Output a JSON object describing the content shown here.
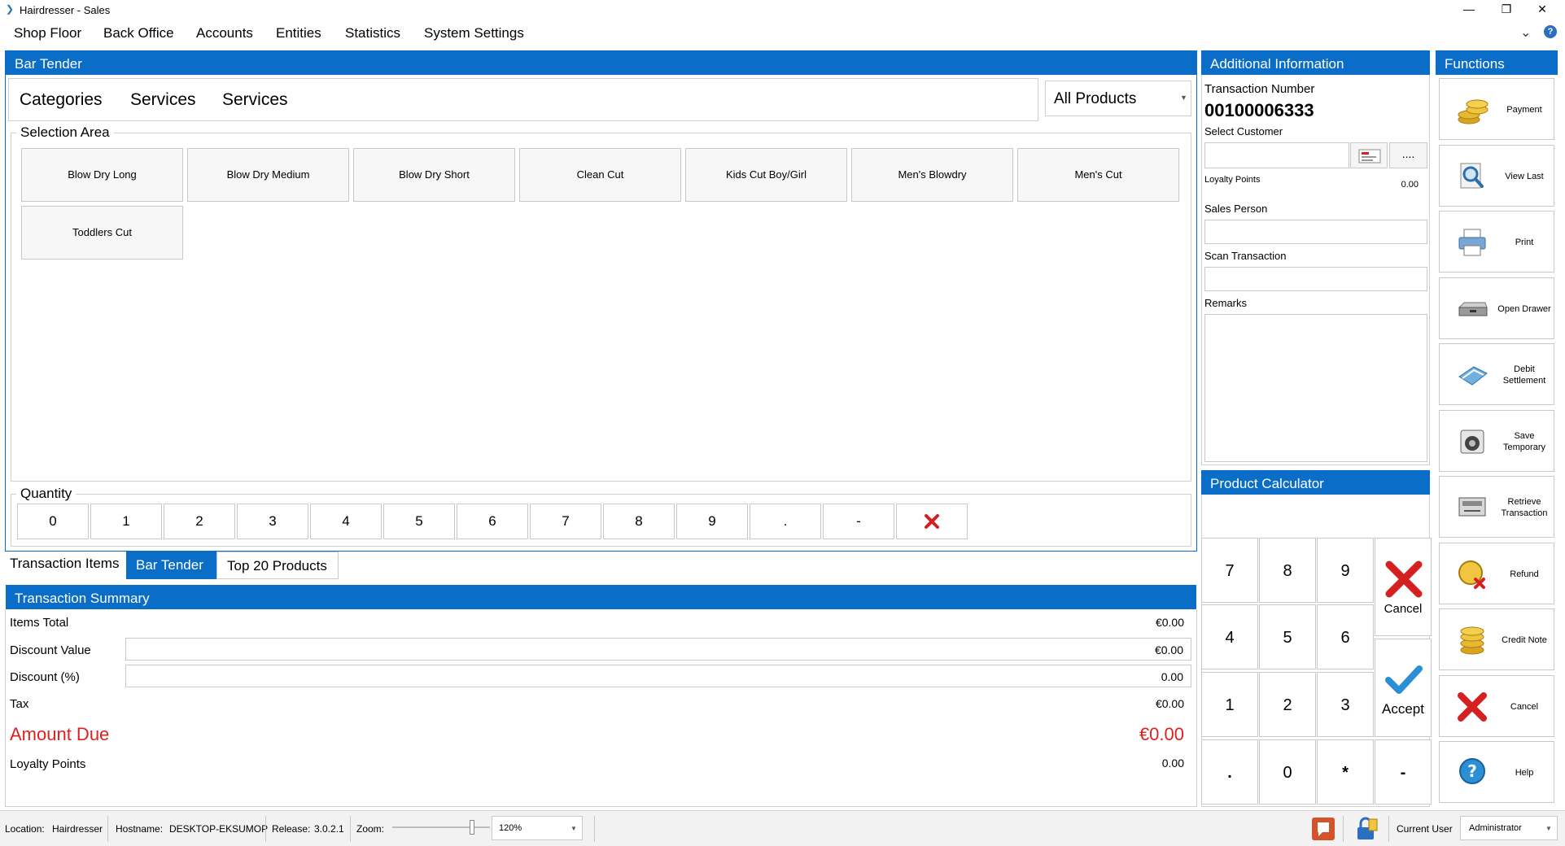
{
  "window": {
    "title": "Hairdresser - Sales",
    "controls": [
      "—",
      "❐",
      "✕"
    ]
  },
  "menu": [
    "Shop Floor",
    "Back Office",
    "Accounts",
    "Entities",
    "Statistics",
    "System Settings"
  ],
  "bar_tender": {
    "title": "Bar Tender",
    "breadcrumb": [
      "Categories",
      "Services",
      "Services"
    ],
    "filter_value": "All Products",
    "selection_area_label": "Selection Area",
    "products": [
      "Blow Dry Long",
      "Blow Dry Medium",
      "Blow Dry Short",
      "Clean Cut",
      "Kids Cut Boy/Girl",
      "Men's Blowdry",
      "Men's Cut",
      "Toddlers Cut"
    ],
    "quantity_label": "Quantity",
    "quantity_keys": [
      "0",
      "1",
      "2",
      "3",
      "4",
      "5",
      "6",
      "7",
      "8",
      "9",
      ".",
      "-"
    ]
  },
  "tabs": {
    "section_label": "Transaction Items",
    "items": [
      "Bar Tender",
      "Top 20 Products"
    ],
    "active": 0
  },
  "summary": {
    "title": "Transaction Summary",
    "items_total_label": "Items Total",
    "items_total": "€0.00",
    "discount_value_label": "Discount Value",
    "discount_value": "€0.00",
    "discount_pct_label": "Discount (%)",
    "discount_pct": "0.00",
    "tax_label": "Tax",
    "tax": "€0.00",
    "amount_due_label": "Amount Due",
    "amount_due": "€0.00",
    "loyalty_label": "Loyalty Points",
    "loyalty": "0.00"
  },
  "additional": {
    "title": "Additional Information",
    "transaction_number_label": "Transaction Number",
    "transaction_number": "00100006333",
    "select_customer_label": "Select Customer",
    "more_label": "....",
    "loyalty_points_label": "Loyalty Points",
    "loyalty_points": "0.00",
    "sales_person_label": "Sales Person",
    "scan_transaction_label": "Scan Transaction",
    "remarks_label": "Remarks"
  },
  "calculator": {
    "title": "Product Calculator",
    "keys": [
      "7",
      "8",
      "9",
      "4",
      "5",
      "6",
      "1",
      "2",
      "3",
      ".",
      "0",
      "*",
      "-"
    ],
    "cancel_label": "Cancel",
    "accept_label": "Accept"
  },
  "functions": {
    "title": "Functions",
    "buttons": [
      {
        "label": "Payment",
        "icon": "coins-icon"
      },
      {
        "label": "View Last",
        "icon": "view-last-icon"
      },
      {
        "label": "Print",
        "icon": "printer-icon"
      },
      {
        "label": "Open Drawer",
        "icon": "cash-drawer-icon"
      },
      {
        "label": "Debit Settlement",
        "icon": "debit-card-icon"
      },
      {
        "label": "Save Temporary",
        "icon": "save-temporary-icon"
      },
      {
        "label": "Retrieve Transaction",
        "icon": "retrieve-icon"
      },
      {
        "label": "Refund",
        "icon": "refund-icon"
      },
      {
        "label": "Credit Note",
        "icon": "credit-note-icon"
      },
      {
        "label": "Cancel",
        "icon": "cancel-icon"
      },
      {
        "label": "Help",
        "icon": "help-icon"
      }
    ]
  },
  "status": {
    "location_label": "Location:",
    "location": "Hairdresser",
    "hostname_label": "Hostname:",
    "hostname": "DESKTOP-EKSUMOP",
    "release_label": "Release:",
    "release": "3.0.2.1",
    "zoom_label": "Zoom:",
    "zoom": "120%",
    "current_user_label": "Current User",
    "current_user": "Administrator"
  },
  "colors": {
    "accent": "#0a6ec8",
    "amount_due": "#e01f1f",
    "cancel_red": "#d42020",
    "accept_blue": "#2b8fd6"
  }
}
